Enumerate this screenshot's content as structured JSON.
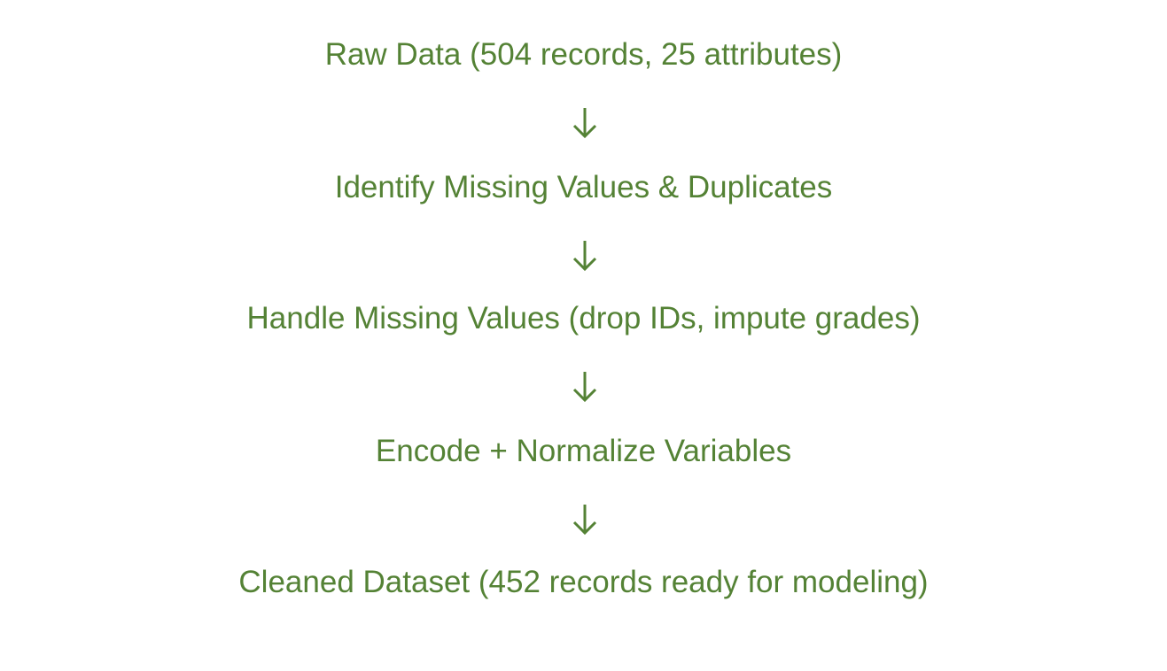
{
  "diagram": {
    "color": "#548235",
    "steps": [
      "Raw Data (504 records, 25 attributes)",
      "Identify Missing Values & Duplicates",
      "Handle Missing Values (drop IDs, impute grades)",
      "Encode + Normalize Variables",
      "Cleaned Dataset (452 records ready for modeling)"
    ],
    "connector_icon": "arrow-down-icon"
  }
}
